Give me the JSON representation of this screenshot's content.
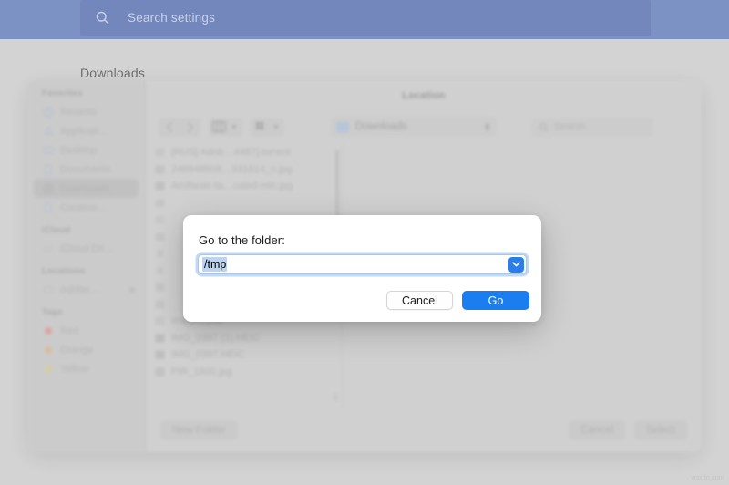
{
  "topbar": {
    "search_icon": "search-icon",
    "search_placeholder": "Search settings"
  },
  "desktop": {
    "heading": "Downloads"
  },
  "finder": {
    "window_title": "Location",
    "sidebar": [
      {
        "type": "group",
        "label": "Favorites"
      },
      {
        "type": "item",
        "label": "Recents",
        "icon": "clock-icon",
        "selected": false
      },
      {
        "type": "item",
        "label": "Applicati…",
        "icon": "applications-icon",
        "selected": false
      },
      {
        "type": "item",
        "label": "Desktop",
        "icon": "desktop-icon",
        "selected": false
      },
      {
        "type": "item",
        "label": "Documents",
        "icon": "document-icon",
        "selected": false
      },
      {
        "type": "item",
        "label": "Downloads",
        "icon": "downloads-icon",
        "selected": true
      },
      {
        "type": "item",
        "label": "Creative…",
        "icon": "document-icon",
        "selected": false
      },
      {
        "type": "group",
        "label": "iCloud"
      },
      {
        "type": "item",
        "label": "iCloud Dri…",
        "icon": "cloud-icon",
        "selected": false
      },
      {
        "type": "group",
        "label": "Locations"
      },
      {
        "type": "item",
        "label": "Adobe…",
        "icon": "disk-icon",
        "selected": false,
        "eject": true
      },
      {
        "type": "group",
        "label": "Tags"
      },
      {
        "type": "tag",
        "label": "Red",
        "color": "#e8837f"
      },
      {
        "type": "tag",
        "label": "Orange",
        "color": "#e5b174"
      },
      {
        "type": "tag",
        "label": "Yellow",
        "color": "#dfd07c"
      }
    ],
    "toolbar": {
      "back_icon": "chevron-left-icon",
      "forward_icon": "chevron-right-icon",
      "view_icon": "column-view-icon",
      "view_chevron": "chevron-down-icon",
      "group_icon": "grid-view-icon",
      "group_chevron": "chevron-down-icon",
      "location_folder_icon": "folder-icon",
      "location_value": "Downloads",
      "location_stepper_icon": "up-down-arrows-icon",
      "search_icon": "search-icon",
      "search_placeholder": "Search"
    },
    "files": [
      {
        "name": "[RUS] Adob…4487].torrent",
        "icon": "torrent-file-icon"
      },
      {
        "name": "248948508…331614_n.jpg",
        "icon": "image-file-icon"
      },
      {
        "name": "Amfiteatr-ta…caled-min.jpg",
        "icon": "image-file-icon"
      },
      {
        "name": "",
        "icon": "file-icon"
      },
      {
        "name": "",
        "icon": "file-icon"
      },
      {
        "name": "",
        "icon": "file-icon"
      },
      {
        "name": "",
        "icon": "file-icon"
      },
      {
        "name": "",
        "icon": "file-icon"
      },
      {
        "name": "",
        "icon": "file-icon"
      },
      {
        "name": "",
        "icon": "file-icon"
      },
      {
        "name": "images.psd",
        "icon": "psd-file-icon"
      },
      {
        "name": "IMG_0397 (1).HEIC",
        "icon": "heic-file-icon"
      },
      {
        "name": "IMG_0397.HEIC",
        "icon": "heic-file-icon"
      },
      {
        "name": "PIR_1600.jpg",
        "icon": "image-file-icon"
      }
    ],
    "bottom": {
      "new_folder_label": "New Folder",
      "cancel_label": "Cancel",
      "select_label": "Select"
    }
  },
  "modal": {
    "label": "Go to the folder:",
    "input_value": "/tmp",
    "input_dropdown_icon": "chevron-down-icon",
    "cancel_label": "Cancel",
    "confirm_label": "Go",
    "accent_color": "#1a7ef0",
    "selection_color": "#bcd4f0"
  },
  "watermark": {
    "text": "wsxdn.com"
  }
}
